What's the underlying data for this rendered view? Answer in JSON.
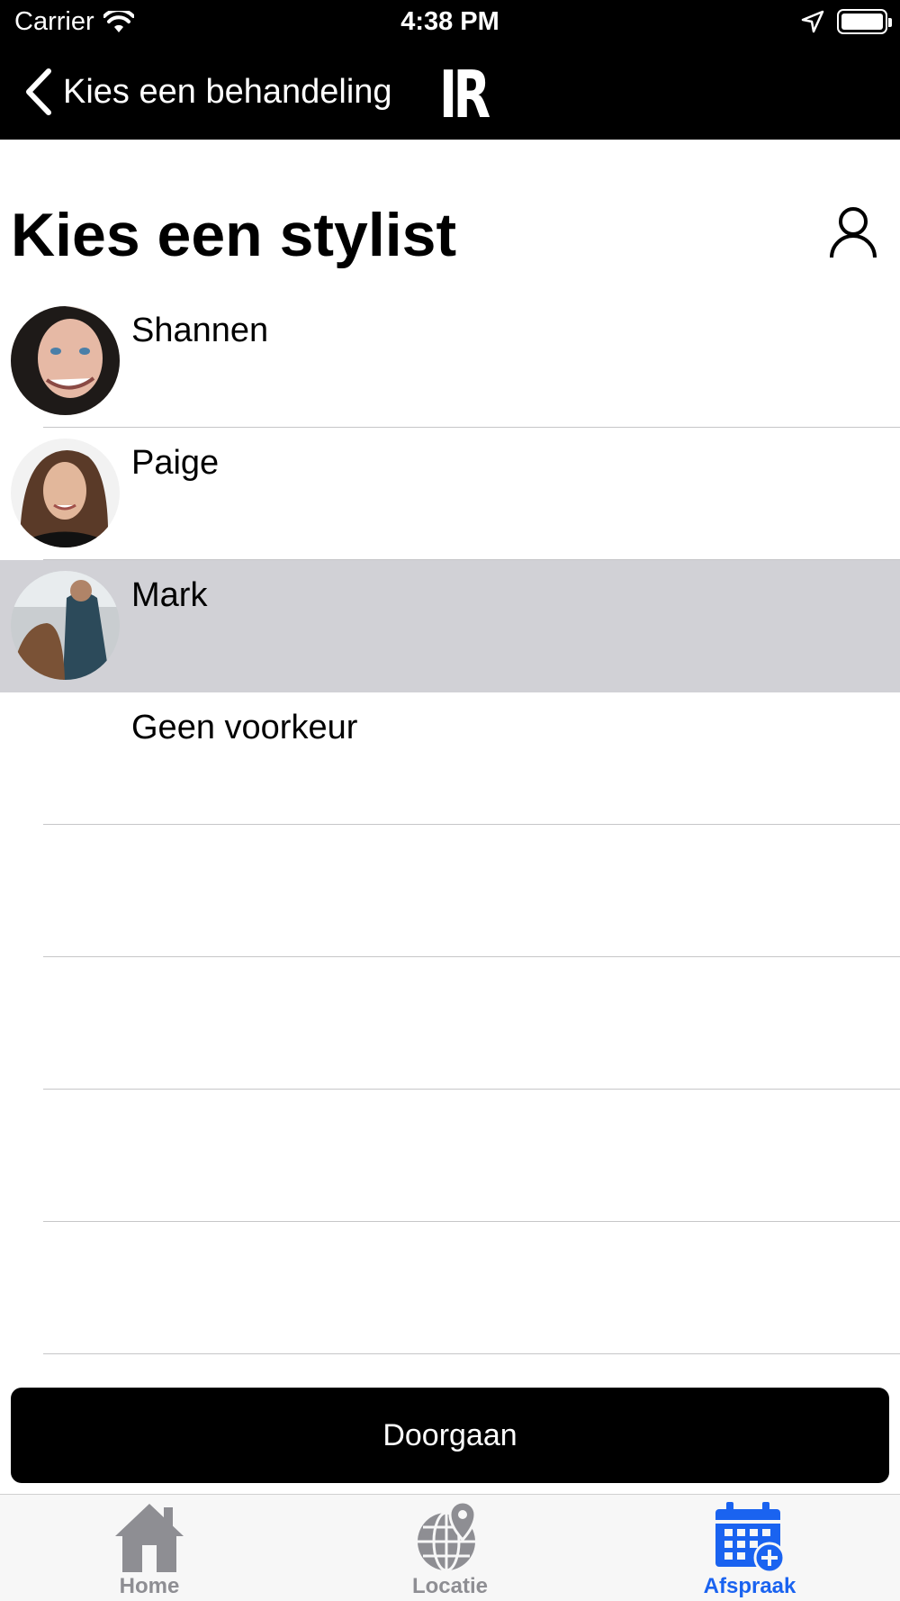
{
  "status_bar": {
    "carrier": "Carrier",
    "time": "4:38 PM",
    "icons": [
      "wifi-icon",
      "location-arrow-icon",
      "battery-icon"
    ]
  },
  "nav": {
    "back_label": "Kies een behandeling",
    "logo_text": "IR"
  },
  "header": {
    "title": "Kies een stylist",
    "account_icon": "person-icon"
  },
  "stylists": [
    {
      "name": "Shannen",
      "selected": false
    },
    {
      "name": "Paige",
      "selected": false
    },
    {
      "name": "Mark",
      "selected": true
    },
    {
      "name": "Geen voorkeur",
      "selected": false
    }
  ],
  "continue_button": {
    "label": "Doorgaan"
  },
  "tabs": [
    {
      "label": "Home",
      "icon": "house-icon",
      "active": false
    },
    {
      "label": "Locatie",
      "icon": "globe-pin-icon",
      "active": false
    },
    {
      "label": "Afspraak",
      "icon": "calendar-add-icon",
      "active": true
    }
  ],
  "colors": {
    "nav_background": "#000000",
    "selected_row": "#d1d1d6",
    "tab_active": "#1a63f0",
    "tab_inactive": "#8e8e93"
  }
}
